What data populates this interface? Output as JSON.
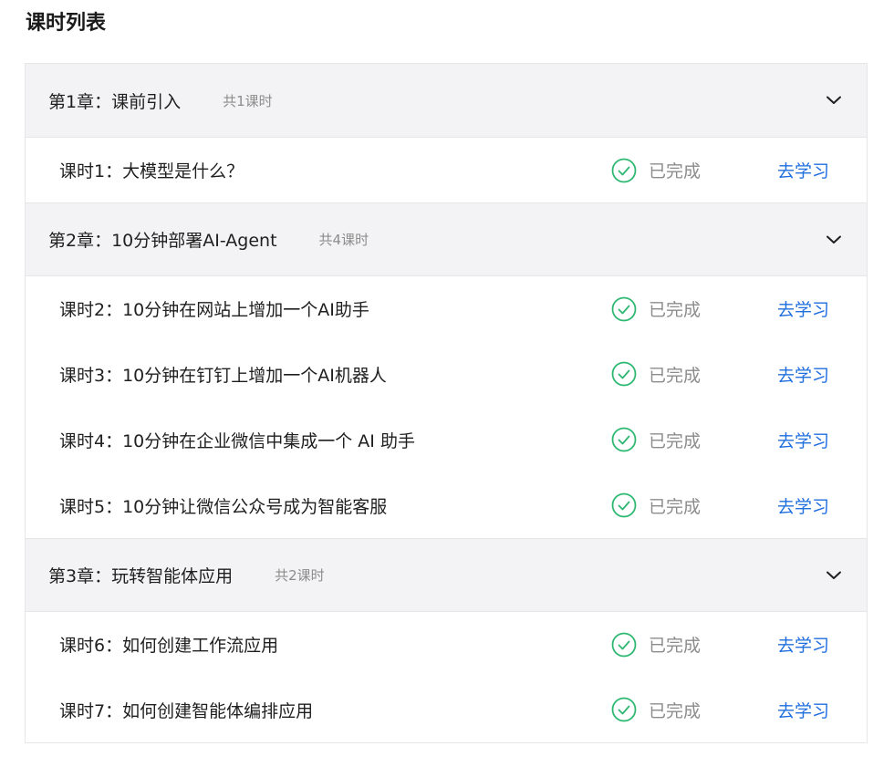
{
  "page": {
    "title": "课时列表"
  },
  "colors": {
    "chapter_bg": "#f3f3f5",
    "status_green": "#2eb872",
    "link_blue": "#1f6fde",
    "muted_text": "#8c8c8c",
    "border": "#e6e6e6"
  },
  "chapters": [
    {
      "title": "第1章：课前引入",
      "count": "共1课时",
      "expand_icon": "chevron-down-icon",
      "lessons": [
        {
          "title": "课时1：大模型是什么？",
          "status": "已完成",
          "action": "去学习",
          "status_icon": "check-circle-icon"
        }
      ]
    },
    {
      "title": "第2章：10分钟部署AI-Agent",
      "count": "共4课时",
      "expand_icon": "chevron-down-icon",
      "lessons": [
        {
          "title": "课时2：10分钟在网站上增加一个AI助手",
          "status": "已完成",
          "action": "去学习",
          "status_icon": "check-circle-icon"
        },
        {
          "title": "课时3：10分钟在钉钉上增加一个AI机器人",
          "status": "已完成",
          "action": "去学习",
          "status_icon": "check-circle-icon"
        },
        {
          "title": "课时4：10分钟在企业微信中集成一个 AI 助手",
          "status": "已完成",
          "action": "去学习",
          "status_icon": "check-circle-icon"
        },
        {
          "title": "课时5：10分钟让微信公众号成为智能客服",
          "status": "已完成",
          "action": "去学习",
          "status_icon": "check-circle-icon"
        }
      ]
    },
    {
      "title": "第3章：玩转智能体应用",
      "count": "共2课时",
      "expand_icon": "chevron-down-icon",
      "lessons": [
        {
          "title": "课时6：如何创建工作流应用",
          "status": "已完成",
          "action": "去学习",
          "status_icon": "check-circle-icon"
        },
        {
          "title": "课时7：如何创建智能体编排应用",
          "status": "已完成",
          "action": "去学习",
          "status_icon": "check-circle-icon"
        }
      ]
    }
  ]
}
